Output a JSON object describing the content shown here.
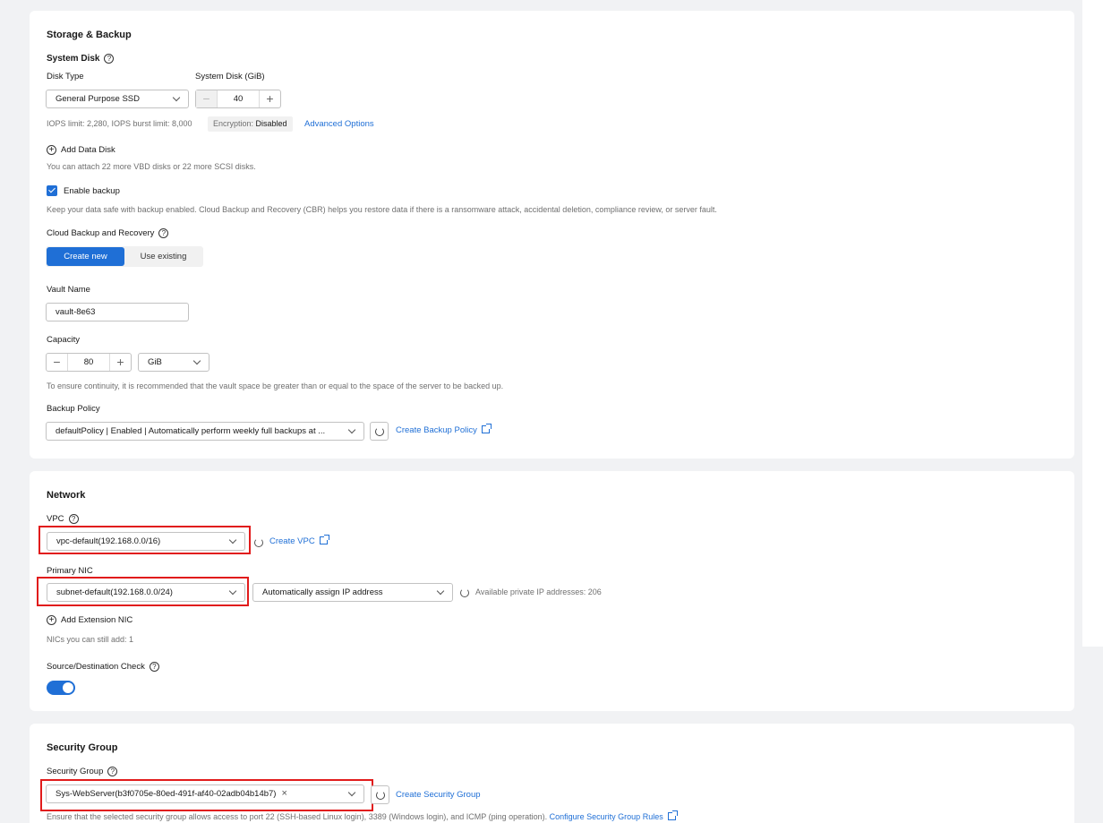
{
  "storage": {
    "title": "Storage & Backup",
    "system_disk_title": "System Disk",
    "disk_type_label": "Disk Type",
    "disk_type_value": "General Purpose SSD",
    "system_disk_size_label": "System Disk (GiB)",
    "system_disk_size_value": "40",
    "iops_text": "IOPS limit: 2,280, IOPS burst limit: 8,000",
    "encryption_label": "Encryption:",
    "encryption_value": "Disabled",
    "advanced_options": "Advanced Options",
    "add_data_disk": "Add Data Disk",
    "attach_hint": "You can attach 22 more VBD disks or 22 more SCSI disks.",
    "enable_backup_label": "Enable backup",
    "enable_backup_checked": true,
    "backup_hint": "Keep your data safe with backup enabled. Cloud Backup and Recovery (CBR) helps you restore data if there is a ransomware attack, accidental deletion, compliance review, or server fault.",
    "cbr_label": "Cloud Backup and Recovery",
    "cbr_options": [
      "Create new",
      "Use existing"
    ],
    "vault_name_label": "Vault Name",
    "vault_name_value": "vault-8e63",
    "capacity_label": "Capacity",
    "capacity_value": "80",
    "capacity_unit": "GiB",
    "capacity_hint": "To ensure continuity, it is recommended that the vault space be greater than or equal to the space of the server to be backed up.",
    "backup_policy_label": "Backup Policy",
    "backup_policy_value": "defaultPolicy | Enabled | Automatically perform weekly full backups at ...",
    "create_backup_policy": "Create Backup Policy"
  },
  "network": {
    "title": "Network",
    "vpc_label": "VPC",
    "vpc_value": "vpc-default(192.168.0.0/16)",
    "create_vpc": "Create VPC",
    "primary_nic_label": "Primary NIC",
    "subnet_value": "subnet-default(192.168.0.0/24)",
    "ip_mode_value": "Automatically assign IP address",
    "available_ips": "Available private IP addresses: 206",
    "add_extension_nic": "Add Extension NIC",
    "nics_hint": "NICs you can still add: 1",
    "src_dst_check_label": "Source/Destination Check",
    "src_dst_check_on": true
  },
  "security_group": {
    "title": "Security Group",
    "label": "Security Group",
    "selected_tag": "Sys-WebServer(b3f0705e-80ed-491f-af40-02adb04b14b7)",
    "create_link": "Create Security Group",
    "hint": "Ensure that the selected security group allows access to port 22 (SSH-based Linux login), 3389 (Windows login), and ICMP (ping operation).",
    "configure_rules": "Configure Security Group Rules"
  },
  "colors": {
    "accent": "#1f6fd6",
    "highlight": "#e11b1b",
    "background": "#f1f2f4"
  }
}
